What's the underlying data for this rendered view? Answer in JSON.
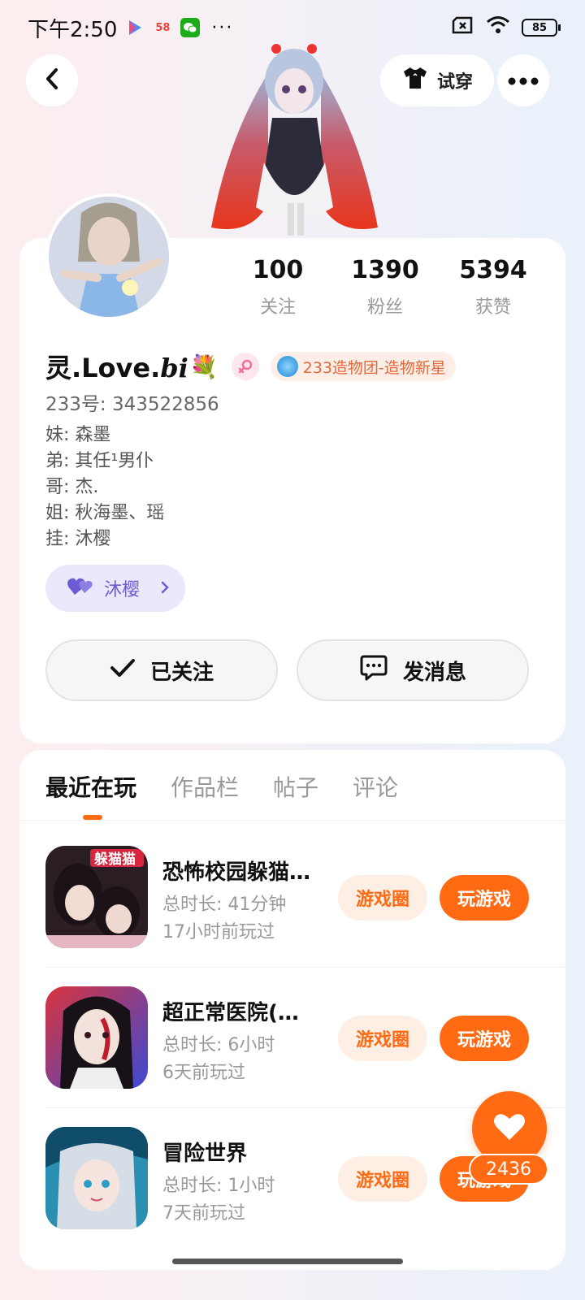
{
  "status_bar": {
    "time": "下午2:50",
    "app_58": "58",
    "more": "···",
    "battery": "85"
  },
  "header": {
    "tryon_label": "试穿"
  },
  "profile": {
    "stats": [
      {
        "value": "100",
        "label": "关注"
      },
      {
        "value": "1390",
        "label": "粉丝"
      },
      {
        "value": "5394",
        "label": "获赞"
      }
    ],
    "name": "灵.Love.",
    "name_italic": "bi",
    "name_emoji": "💐",
    "gender_icon": "female-icon",
    "badge": "233造物团-造物新星",
    "uid": "233号: 343522856",
    "bio_lines": [
      "妹: 森墨",
      "弟: 其任¹男仆",
      "哥: 杰.",
      "姐: 秋海墨、瑶",
      "挂: 沐樱"
    ],
    "cp_tag": "沐樱",
    "follow_label": "已关注",
    "message_label": "发消息"
  },
  "tabs": [
    "最近在玩",
    "作品栏",
    "帖子",
    "评论"
  ],
  "games": [
    {
      "title": "恐怖校园躲猫…",
      "duration": "总时长: 41分钟",
      "last_played": "17小时前玩过",
      "circle_label": "游戏圈",
      "play_label": "玩游戏",
      "icon_badge": "躲猫猫"
    },
    {
      "title": "超正常医院(…",
      "duration": "总时长: 6小时",
      "last_played": "6天前玩过",
      "circle_label": "游戏圈",
      "play_label": "玩游戏"
    },
    {
      "title": "冒险世界",
      "duration": "总时长: 1小时",
      "last_played": "7天前玩过",
      "circle_label": "游戏圈",
      "play_label": "玩游戏"
    }
  ],
  "like": {
    "count": "2436"
  },
  "colors": {
    "accent": "#ff6a13",
    "accent_light": "#feeee4",
    "cp_purple": "#6b5cd6"
  }
}
